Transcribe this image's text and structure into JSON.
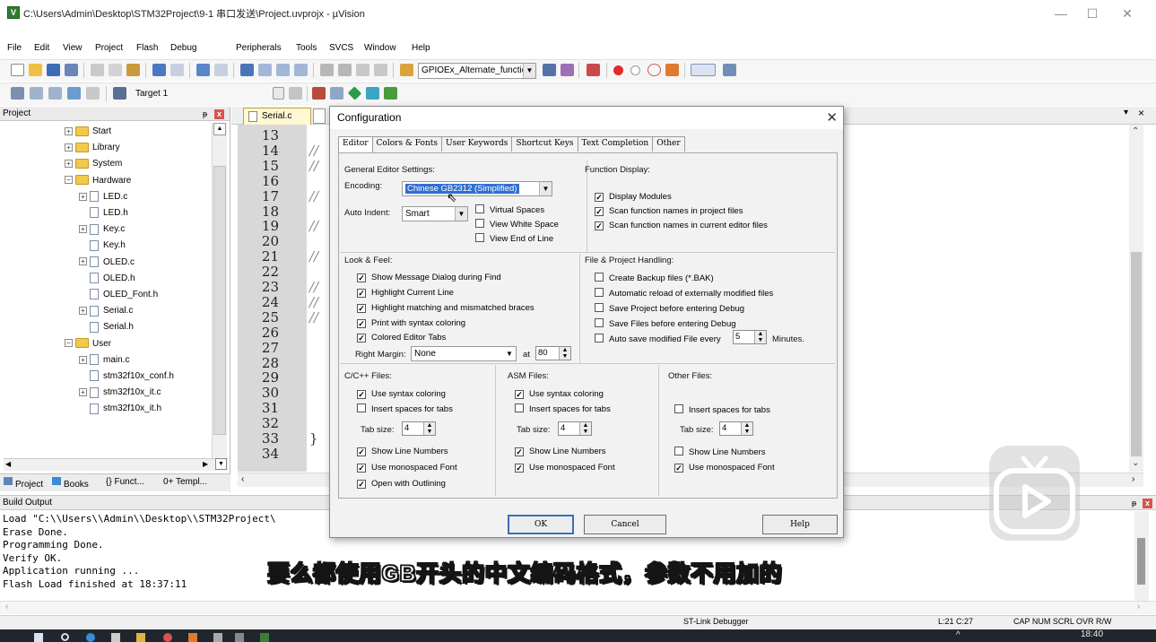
{
  "window": {
    "title": "C:\\Users\\Admin\\Desktop\\STM32Project\\9-1 串口发送\\Project.uvprojx - µVision",
    "min": "—",
    "max": "☐",
    "close": "✕"
  },
  "menu": [
    "File",
    "Edit",
    "View",
    "Project",
    "Flash",
    "Debug",
    "Peripherals",
    "Tools",
    "SVCS",
    "Window",
    "Help"
  ],
  "toolbar": {
    "find_combo": "GPIOEx_Alternate_functic",
    "target_combo": "Target 1"
  },
  "project_panel": {
    "title": "Project",
    "tree": [
      {
        "label": "Start",
        "type": "folder",
        "expanded": false
      },
      {
        "label": "Library",
        "type": "folder",
        "expanded": false
      },
      {
        "label": "System",
        "type": "folder",
        "expanded": false
      },
      {
        "label": "Hardware",
        "type": "folder",
        "expanded": true
      },
      {
        "label": "LED.c",
        "type": "file",
        "expandable": true
      },
      {
        "label": "LED.h",
        "type": "file"
      },
      {
        "label": "Key.c",
        "type": "file",
        "expandable": true
      },
      {
        "label": "Key.h",
        "type": "file"
      },
      {
        "label": "OLED.c",
        "type": "file",
        "expandable": true
      },
      {
        "label": "OLED.h",
        "type": "file"
      },
      {
        "label": "OLED_Font.h",
        "type": "file"
      },
      {
        "label": "Serial.c",
        "type": "file",
        "expandable": true
      },
      {
        "label": "Serial.h",
        "type": "file"
      },
      {
        "label": "User",
        "type": "folder",
        "expanded": true
      },
      {
        "label": "main.c",
        "type": "file",
        "expandable": true
      },
      {
        "label": "stm32f10x_conf.h",
        "type": "file"
      },
      {
        "label": "stm32f10x_it.c",
        "type": "file",
        "expandable": true
      },
      {
        "label": "stm32f10x_it.h",
        "type": "file"
      }
    ],
    "tabs": [
      "Project",
      "Books",
      "{} Funct...",
      "0+ Templ..."
    ]
  },
  "editor": {
    "tabs": [
      "Serial.c"
    ],
    "line_numbers": [
      "13",
      "14",
      "15",
      "16",
      "17",
      "18",
      "19",
      "20",
      "21",
      "22",
      "23",
      "24",
      "25",
      "26",
      "27",
      "28",
      "29",
      "30",
      "31",
      "32",
      "33",
      "34"
    ],
    "comment_mark": "//",
    "brace": "}"
  },
  "dialog": {
    "title": "Configuration",
    "tabs": [
      "Editor",
      "Colors & Fonts",
      "User Keywords",
      "Shortcut Keys",
      "Text Completion",
      "Other"
    ],
    "general": {
      "heading": "General Editor Settings:",
      "encoding_label": "Encoding:",
      "encoding_value": "Chinese GB2312 (Simplified)",
      "auto_indent_label": "Auto Indent:",
      "auto_indent_value": "Smart",
      "virtual_spaces": "Virtual Spaces",
      "view_white_space": "View White Space",
      "view_end_of_line": "View End of Line"
    },
    "function_display": {
      "heading": "Function Display:",
      "items": [
        "Display Modules",
        "Scan function names in project files",
        "Scan function names in current editor files"
      ]
    },
    "look_feel": {
      "heading": "Look & Feel:",
      "items": [
        "Show Message Dialog during Find",
        "Highlight Current Line",
        "Highlight matching and mismatched braces",
        "Print with syntax coloring",
        "Colored Editor Tabs"
      ],
      "right_margin_label": "Right Margin:",
      "right_margin_value": "None",
      "at_label": "at",
      "at_value": "80"
    },
    "file_project": {
      "heading": "File & Project Handling:",
      "items": [
        "Create Backup files (*.BAK)",
        "Automatic reload of externally modified files",
        "Save Project before entering Debug",
        "Save Files before entering Debug"
      ],
      "autosave": "Auto save modified File every",
      "autosave_value": "5",
      "minutes": "Minutes."
    },
    "cpp": {
      "heading": "C/C++ Files:",
      "syntax": "Use syntax coloring",
      "spaces": "Insert spaces for tabs",
      "tab_label": "Tab size:",
      "tab_value": "4",
      "line_numbers": "Show Line Numbers",
      "mono": "Use monospaced Font",
      "outlining": "Open with Outlining"
    },
    "asm": {
      "heading": "ASM Files:",
      "syntax": "Use syntax coloring",
      "spaces": "Insert spaces for tabs",
      "tab_label": "Tab size:",
      "tab_value": "4",
      "line_numbers": "Show Line Numbers",
      "mono": "Use monospaced Font"
    },
    "other": {
      "heading": "Other Files:",
      "spaces": "Insert spaces for tabs",
      "tab_label": "Tab size:",
      "tab_value": "4",
      "line_numbers": "Show Line Numbers",
      "mono": "Use monospaced Font"
    },
    "buttons": {
      "ok": "OK",
      "cancel": "Cancel",
      "help": "Help"
    }
  },
  "build_output": {
    "title": "Build Output",
    "lines": [
      "Load \"C:\\\\Users\\\\Admin\\\\Desktop\\\\STM32Project\\",
      "Erase Done.",
      "Programming Done.",
      "Verify OK.",
      "Application running ...",
      "Flash Load finished at 18:37:11"
    ]
  },
  "status": {
    "debugger": "ST-Link Debugger",
    "position": "L:21 C:27",
    "flags": "CAP  NUM  SCRL  OVR  R/W"
  },
  "subtitle": "要么都使用GB开头的中文编码格式，参数不用加的",
  "taskbar": {
    "time": "18:40"
  }
}
